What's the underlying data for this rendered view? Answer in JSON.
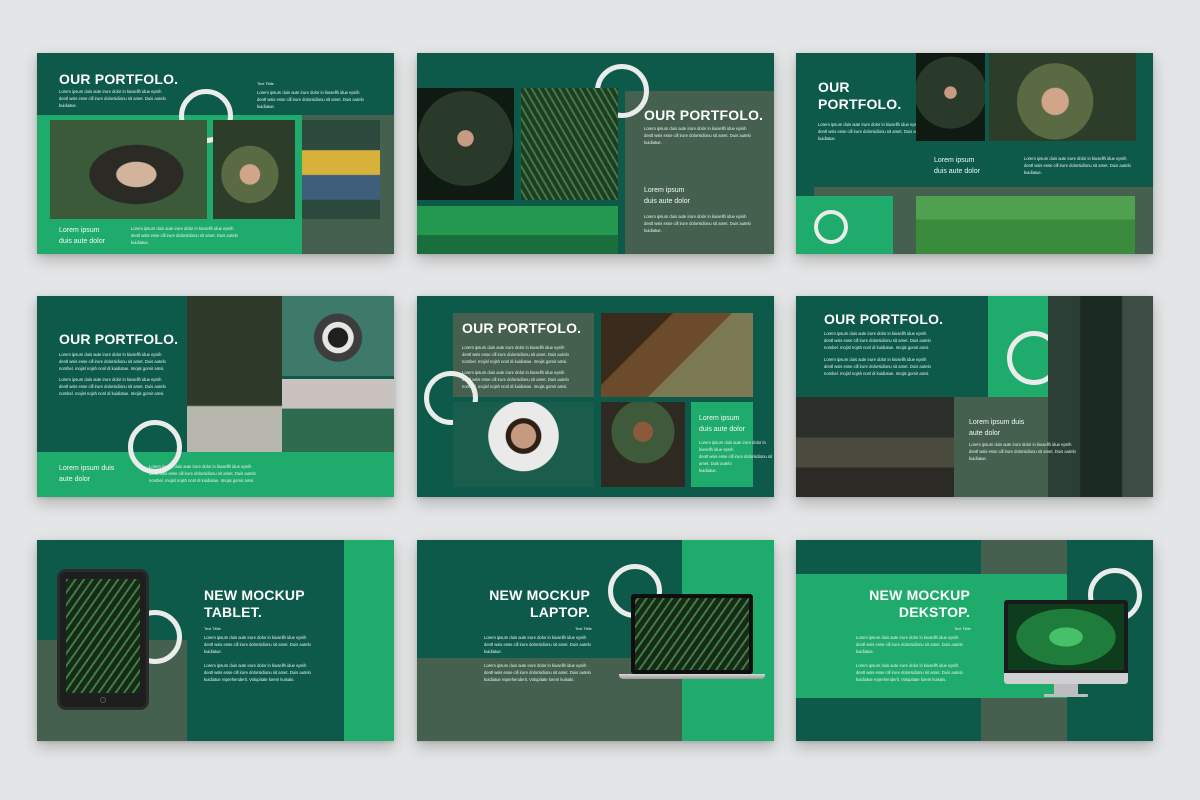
{
  "canvas": {
    "background": "#e4e5e6"
  },
  "colors": {
    "dark_green": "#0d5a4a",
    "accent_green": "#1fab6c",
    "gray_green": "#45604f",
    "ring": "#e9ecea"
  },
  "slides": [
    {
      "title": "OUR PORTFOLO.",
      "text_title": "Text Tittle",
      "body": "Lorem ipsum duis aute irure dolor in kiusellh idue epnih\ndentl wsis esse cill irure dolorsidionu sit amet. Duis autelo\nkuidiatue.",
      "label": "Lorem   ipsum\nduis aute dolor",
      "body2": "Lorem ipsum duis aute irure dolor in kiusellh idue epnih\ndentl wsis esse cill irure dolorsidionu sit amet. Duis autelo\nkuidiatue."
    },
    {
      "title": "OUR PORTFOLO.",
      "body": "Lorem ipsum duis aute irure dolor in kiusellh idue epnih\ndentl wsis esse cill irure dolorsidionu sit amet. Duis autelo\nkuidiatue.",
      "label": "Lorem   ipsum\nduis aute dolor",
      "body2": "Lorem ipsum duis aute irure dolor in kiusellh idue epnih\ndentl wsis esse cill irure dolorsidionu sit amet. Duis autelo\nkuidiatue."
    },
    {
      "title": "OUR\nPORTFOLO.",
      "body": "Lorem ipsum duis aute irure dolor in kiusellh idue epnih\ndentl wsis esse cill irure dolorsidionu sit amet. Duis autelo\nkuidiatue.",
      "label": "Lorem   ipsum\nduis aute dolor",
      "body2": "Lorem ipsum duis aute irure dolor in kiusellh idue epnih\ndentl wsis esse cill irure dolorsidionu sit amet. Duis autelo\nkuidiatue."
    },
    {
      "title": "OUR PORTFOLO.",
      "body": "Lorem ipsum duis aute irure dolor in kiusellh idue epnih\ndentl wsis esse cill irure dolorsidionu sit amet. Duis autelo\nnombel. mojisl nojsh nonl di kuidiatue. Imojis gomir amsi.",
      "body2": "Lorem ipsum duis aute irure dolor in kiusellh idue epnih\ndentl wsis esse cill irure dolorsidionu sit amet. Duis autelo\nnombel. mojisl nojsh nonl di kuidiatue. Imojis gomir amsi.",
      "label": "Lorem   ipsum duis\naute dolor",
      "body3": "Lorem ipsum duis aute irure dolor in kiusellh idue epnih\ndentl wsis esse cill irure dolorsidionu sit amet. Duis autelo\nnombel. mojisl nojsh nonl di kuidiatue. Imojis gomir amsi."
    },
    {
      "title": "OUR PORTFOLO.",
      "body": "Lorem ipsum duis aute irure dolor in kiusellh idue epnih\ndentl wsis esse cill irure dolorsidionu sit amet. Duis autelo\nnombel. mojisl nojsh nonl di kuidiatue. Imojis gomir amsi.",
      "body2": "Lorem ipsum duis aute irure dolor in kiusellh idue epnih\ndentl wsis esse cill irure dolorsidionu sit amet. Duis autelo\nnombel. mojisl nojsh nonl di kuidiatue. Imojis gomir amsi.",
      "label": "Lorem   ipsum\nduis aute dolor",
      "body3": "Lorem ipsum duis aute irure dolor in kiusellh idue epnih\ndentl wsis esse cill irure dolorsidionu sit amet. Duis autelo\nkuidiatue."
    },
    {
      "title": "OUR PORTFOLO.",
      "body": "Lorem ipsum duis aute irure dolor in kiusellh idue epnih\ndentl wsis esse cill irure dolorsidionu sit amet. Duis autelo\nnombel. mojisl nojsh nonl di kuidiatue. Imojis gomir amsi.",
      "body2": "Lorem ipsum duis aute irure dolor in kiusellh idue epnih\ndentl wsis esse cill irure dolorsidionu sit amet. Duis autelo\nnombel. mojisl nojsh nonl di kuidiatue. Imojis gomir amsi.",
      "label": "Lorem   ipsum duis\naute dolor",
      "body3": "Lorem ipsum duis aute irure dolor in kiusellh idue epnih\ndentl wsis esse cill irure dolorsidionu sit amet. Duis autelo\nkuidiatue."
    },
    {
      "title": "NEW MOCKUP\nTABLET.",
      "text_title": "Text Tittle",
      "body": "Lorem ipsum duis aute irure dolor in kiusellh idue epnih\ndentl wsis esse cill irure dolorsidionu sit amet. Duis autelo\nkuidiatue.",
      "body2": "Lorem ipsum duis aute irure dolor in kiusellh idue epnih\ndentl wsis esse cill irure dolorsidionu sit amet. Duis autelo\nkuidiatue reprehenderit. Volupitate lorem kuisalo."
    },
    {
      "title": "NEW MOCKUP\nLAPTOP.",
      "text_title": "Text Tittle",
      "body": "Lorem ipsum duis aute irure dolor in kiusellh idue epnih\ndentl wsis esse cill irure dolorsidionu sit amet. Duis autelo\nkuidiatue.",
      "body2": "Lorem ipsum duis aute irure dolor in kiusellh idue epnih\ndentl wsis esse cill irure dolorsidionu sit amet. Duis autelo\nkuidiatue reprehenderit. Volupitate lorem kuisalo."
    },
    {
      "title": "NEW MOCKUP\nDEKSTOP.",
      "text_title": "Text Tittle",
      "body": "Lorem ipsum duis aute irure dolor in kiusellh idue epnih\ndentl wsis esse cill irure dolorsidionu sit amet. Duis autelo\nkuidiatue.",
      "body2": "Lorem ipsum duis aute irure dolor in kiusellh idue epnih\ndentl wsis esse cill irure dolorsidionu sit amet. Duis autelo\nkuidiatue reprehenderit. Volupitate lorem kuisalo."
    }
  ]
}
